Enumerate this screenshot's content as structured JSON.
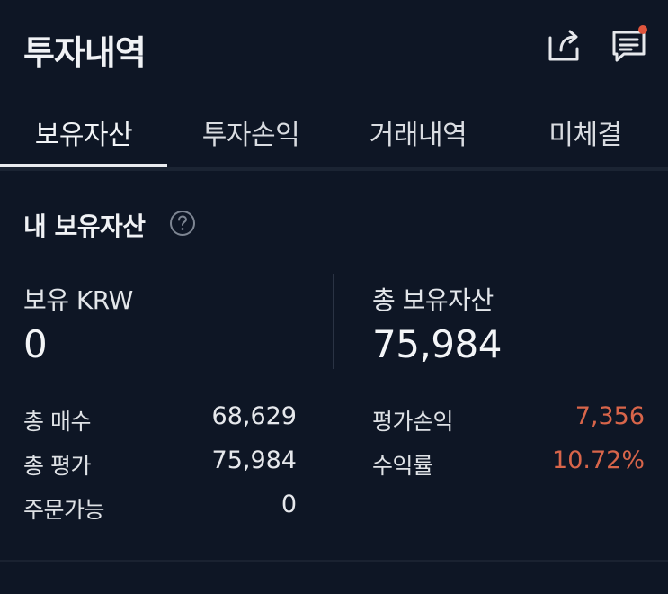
{
  "header": {
    "title": "투자내역"
  },
  "tabs": [
    {
      "label": "보유자산",
      "active": true
    },
    {
      "label": "투자손익",
      "active": false
    },
    {
      "label": "거래내역",
      "active": false
    },
    {
      "label": "미체결",
      "active": false
    }
  ],
  "holdings": {
    "section_title": "내 보유자산",
    "krw_label": "보유 KRW",
    "krw_value": "0",
    "total_assets_label": "총 보유자산",
    "total_assets_value": "75,984",
    "rows_left": [
      {
        "label": "총 매수",
        "value": "68,629"
      },
      {
        "label": "총 평가",
        "value": "75,984"
      },
      {
        "label": "주문가능",
        "value": "0"
      }
    ],
    "rows_right": [
      {
        "label": "평가손익",
        "value": "7,356"
      },
      {
        "label": "수익률",
        "value": "10.72%"
      }
    ]
  },
  "colors": {
    "background": "#0e1625",
    "profit": "#d8654a",
    "notification_dot": "#e0553d"
  },
  "icons": {
    "share": "share-icon",
    "chat": "chat-icon",
    "help": "help-icon"
  }
}
